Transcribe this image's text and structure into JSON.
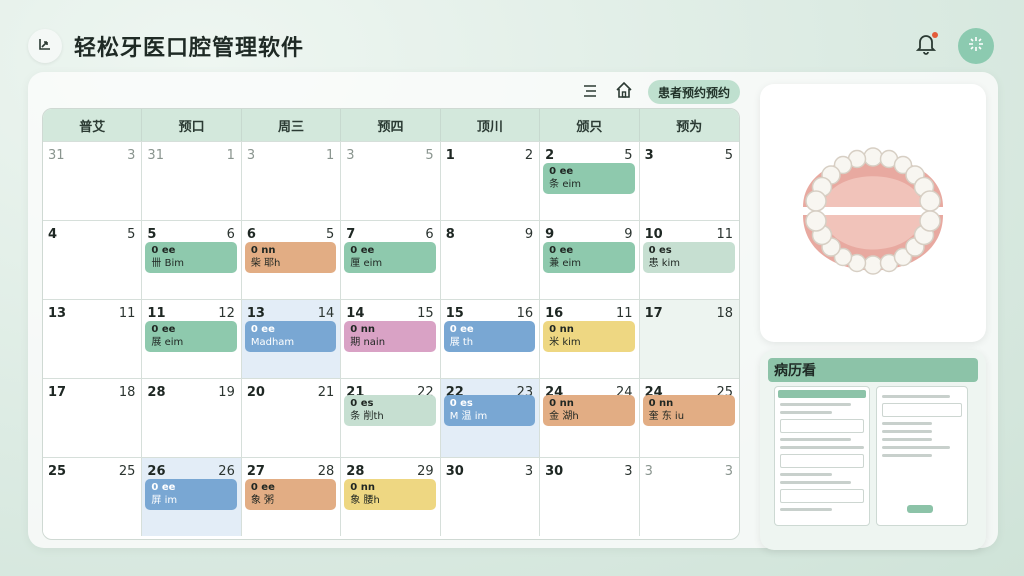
{
  "app": {
    "title": "轻松牙医口腔管理软件",
    "logo_icon": "chart-icon"
  },
  "header_actions": {
    "bell_icon": "bell-icon",
    "sparkle_icon": "sparkle-icon"
  },
  "toolbar": {
    "menu_icon": "menu-icon",
    "home_icon": "home-icon",
    "pill_label": "患者预约预约"
  },
  "calendar": {
    "weekdays": [
      "普艾",
      "预口",
      "周三",
      "预四",
      "顶川",
      "颁只",
      "预为"
    ],
    "rows": [
      [
        {
          "d1": "31",
          "d2": "3",
          "faded": true
        },
        {
          "d1": "31",
          "d2": "1",
          "faded": true
        },
        {
          "d1": "3",
          "d2": "1",
          "faded": true
        },
        {
          "d1": "3",
          "d2": "5",
          "faded": true
        },
        {
          "d1": "1",
          "d2": "2"
        },
        {
          "d1": "2",
          "d2": "5",
          "event": {
            "color": "green",
            "l1": "0 ee",
            "l2": "条 eim"
          }
        },
        {
          "d1": "3",
          "d2": "5"
        }
      ],
      [
        {
          "d1": "4",
          "d2": "5"
        },
        {
          "d1": "5",
          "d2": "6",
          "event": {
            "color": "green",
            "l1": "0 ee",
            "l2": "卌 Bim"
          }
        },
        {
          "d1": "6",
          "d2": "5",
          "event": {
            "color": "orange",
            "l1": "0 nn",
            "l2": "柴 耶h"
          }
        },
        {
          "d1": "7",
          "d2": "6",
          "event": {
            "color": "green",
            "l1": "0 ee",
            "l2": "厘 eim"
          }
        },
        {
          "d1": "8",
          "d2": "9"
        },
        {
          "d1": "9",
          "d2": "9",
          "event": {
            "color": "green",
            "l1": "0 ee",
            "l2": "兼 eim"
          }
        },
        {
          "d1": "10",
          "d2": "11",
          "event": {
            "color": "lgreen",
            "l1": "0 es",
            "l2": "患 kim"
          }
        }
      ],
      [
        {
          "d1": "13",
          "d2": "11"
        },
        {
          "d1": "11",
          "d2": "12",
          "event": {
            "color": "green",
            "l1": "0 ee",
            "l2": "展 eim"
          }
        },
        {
          "d1": "13",
          "d2": "14",
          "blue": true,
          "event": {
            "color": "blue",
            "l1": "0 ee",
            "l2": "Madham"
          }
        },
        {
          "d1": "14",
          "d2": "15",
          "event": {
            "color": "pink",
            "l1": "0 nn",
            "l2": "期 nain"
          }
        },
        {
          "d1": "15",
          "d2": "16",
          "event": {
            "color": "blue",
            "l1": "0 ee",
            "l2": "展 th"
          }
        },
        {
          "d1": "16",
          "d2": "11",
          "event": {
            "color": "yellow",
            "l1": "0 nn",
            "l2": "米 kim"
          }
        },
        {
          "d1": "17",
          "d2": "18",
          "shade": true
        }
      ],
      [
        {
          "d1": "17",
          "d2": "18"
        },
        {
          "d1": "28",
          "d2": "19"
        },
        {
          "d1": "20",
          "d2": "21"
        },
        {
          "d1": "21",
          "d2": "22",
          "event": {
            "color": "lgreen",
            "top2": true,
            "l1": "0 es",
            "l2": "条 削th"
          }
        },
        {
          "d1": "22",
          "d2": "23",
          "blue": true,
          "event": {
            "color": "blue",
            "top2": true,
            "l1": "0 es",
            "l2": "M 温 im"
          }
        },
        {
          "d1": "24",
          "d2": "24",
          "event": {
            "color": "orange",
            "top2": true,
            "l1": "0 nn",
            "l2": "金 湖h"
          }
        },
        {
          "d1": "24",
          "d2": "25",
          "event": {
            "color": "orange",
            "top2": true,
            "l1": "0 nn",
            "l2": "奎 东 iu"
          }
        }
      ],
      [
        {
          "d1": "25",
          "d2": "25"
        },
        {
          "d1": "26",
          "d2": "26",
          "blue": true,
          "event": {
            "color": "blue",
            "l1": "0 ee",
            "l2": "屏 im"
          }
        },
        {
          "d1": "27",
          "d2": "28",
          "event": {
            "color": "orange",
            "l1": "0 ee",
            "l2": "象 粥"
          }
        },
        {
          "d1": "28",
          "d2": "29",
          "event": {
            "color": "yellow",
            "l1": "0 nn",
            "l2": "象 腰h"
          }
        },
        {
          "d1": "30",
          "d2": "3"
        },
        {
          "d1": "30",
          "d2": "3"
        },
        {
          "d1": "3",
          "d2": "3",
          "faded": true
        }
      ]
    ]
  },
  "side": {
    "image_icon": "teeth-diagram-icon",
    "card_title": "病历看"
  }
}
